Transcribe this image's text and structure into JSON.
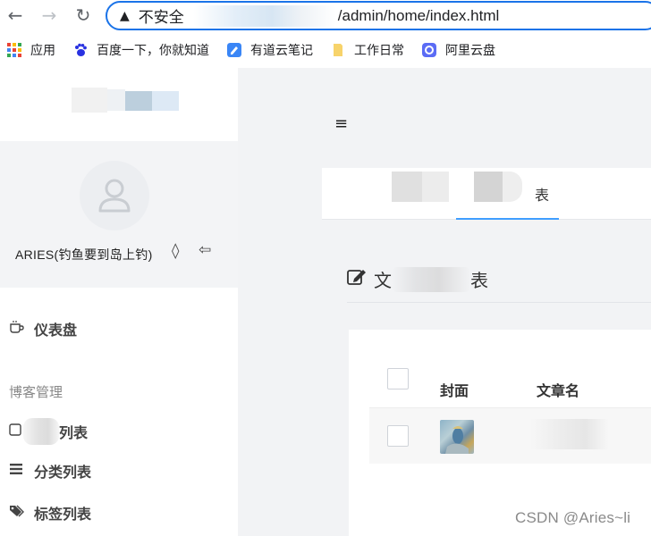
{
  "browser": {
    "back_icon": "←",
    "forward_icon": "→",
    "reload_icon": "↻",
    "warning_icon": "▲",
    "insecure_label": "不安全",
    "url_path": "/admin/home/index.html"
  },
  "bookmarks": [
    {
      "label": "应用",
      "icon": "apps-grid-icon"
    },
    {
      "label": "百度一下，你就知道",
      "icon": "baidu-paw-icon",
      "color": "#2932e1"
    },
    {
      "label": "有道云笔记",
      "icon": "youdao-note-icon",
      "color": "#3a86f6"
    },
    {
      "label": "工作日常",
      "icon": "folder-icon",
      "color": "#f7d36b"
    },
    {
      "label": "阿里云盘",
      "icon": "aliyun-drive-icon",
      "color": "#5b6cf5"
    }
  ],
  "sidebar": {
    "username": "ARIES(钓鱼要到岛上钓)",
    "drop_icon": "◊",
    "logout_icon": "⇦",
    "dashboard_label": "仪表盘",
    "group_label": "博客管理",
    "article_list_partial": "列表",
    "category_list": "分类列表",
    "tag_list": "标签列表"
  },
  "main": {
    "menu_icon": "≡",
    "tab_partial": "表",
    "title_partial_left": "文",
    "title_partial_right": "表",
    "table": {
      "col_cover": "封面",
      "col_title": "文章名"
    }
  },
  "watermark": "CSDN @Aries~li"
}
